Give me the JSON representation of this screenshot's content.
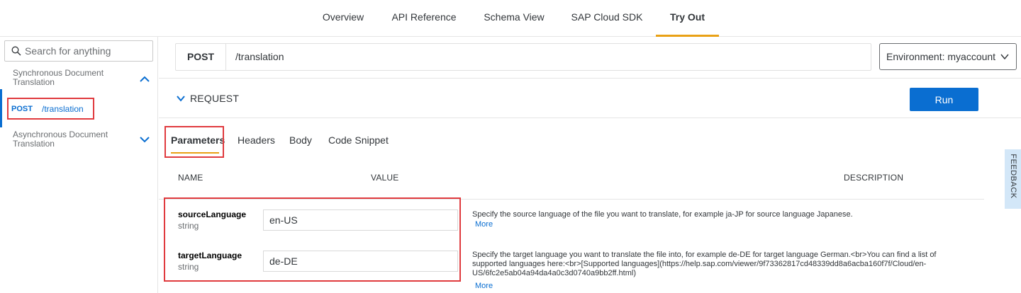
{
  "top_nav": {
    "tabs": [
      {
        "label": "Overview"
      },
      {
        "label": "API Reference"
      },
      {
        "label": "Schema View"
      },
      {
        "label": "SAP Cloud SDK"
      },
      {
        "label": "Try Out"
      }
    ],
    "active_tab": "Try Out"
  },
  "sidebar": {
    "search_placeholder": "Search for anything",
    "groups": [
      {
        "label": "Synchronous Document Translation",
        "expanded": true
      },
      {
        "label": "Asynchronous Document Translation",
        "expanded": false
      }
    ],
    "endpoint": {
      "method": "POST",
      "path": "/translation"
    }
  },
  "endpoint_bar": {
    "method": "POST",
    "path": "/translation"
  },
  "environment": {
    "label": "Environment: myaccount"
  },
  "request": {
    "label": "REQUEST",
    "run_label": "Run"
  },
  "param_tabs": [
    {
      "label": "Parameters"
    },
    {
      "label": "Headers"
    },
    {
      "label": "Body"
    },
    {
      "label": "Code Snippet"
    }
  ],
  "table_headers": {
    "name": "NAME",
    "value": "VALUE",
    "description": "DESCRIPTION"
  },
  "params": [
    {
      "name": "sourceLanguage",
      "type": "string",
      "value": "en-US",
      "description": "Specify the source language of the file you want to translate, for example ja-JP for source language Japanese.",
      "more": "More"
    },
    {
      "name": "targetLanguage",
      "type": "string",
      "value": "de-DE",
      "description": "Specify the target language you want to translate the file into, for example de-DE for target language German.<br>You can find a list of supported languages here:<br>[Supported languages](https://help.sap.com/viewer/9f73362817cd48339dd8a6acba160f7f/Cloud/en-US/6fc2e5ab04a94da4a0c3d0740a9bb2ff.html)",
      "more": "More"
    }
  ],
  "feedback": {
    "label": "FEEDBACK"
  },
  "colors": {
    "accent": "#0a6ed1",
    "tab_underline": "#e9a115",
    "highlight": "#e03a3e"
  }
}
